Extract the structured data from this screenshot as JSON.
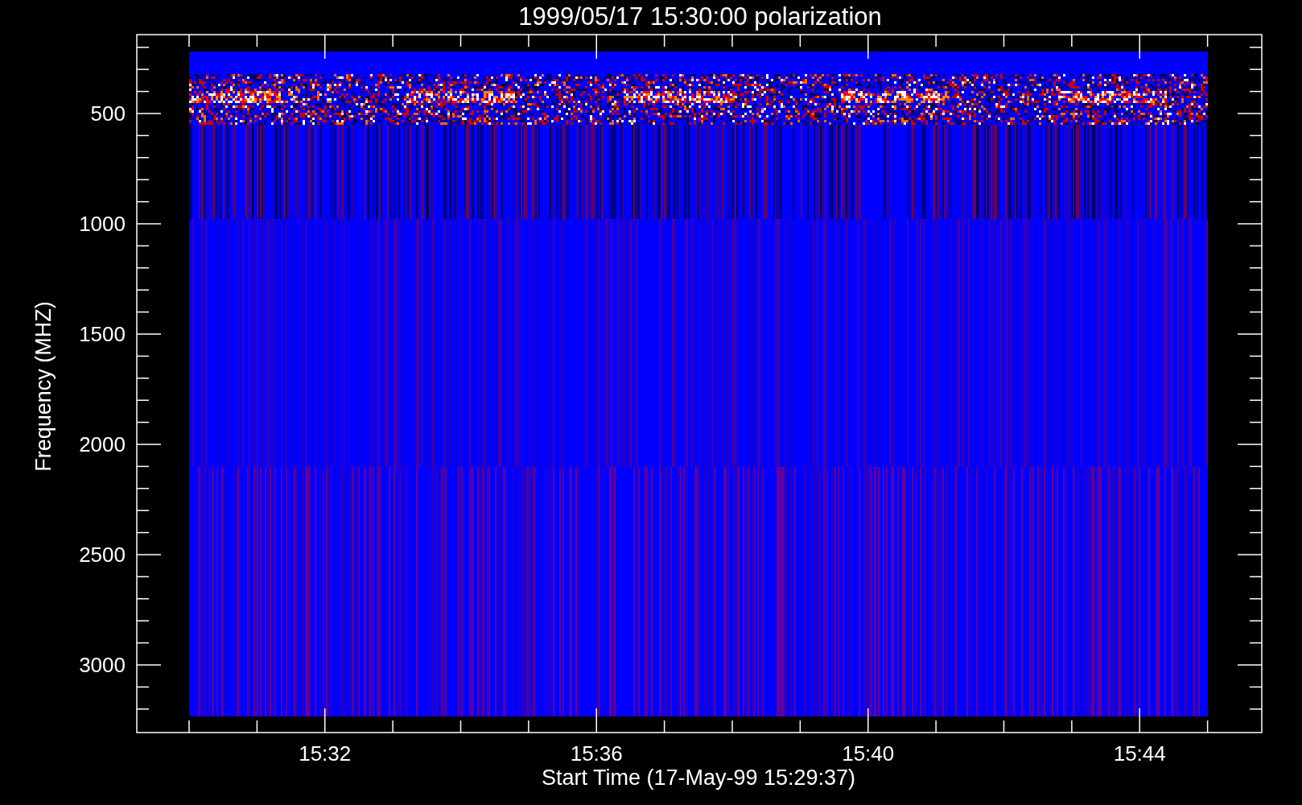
{
  "plot": {
    "title": "1999/05/17 15:30:00 polarization",
    "y_axis": {
      "label": "Frequency (MHZ)",
      "tick_labels": [
        "500",
        "1000",
        "1500",
        "2000",
        "2500",
        "3000"
      ]
    },
    "x_axis": {
      "label": "Start Time (17-May-99 15:29:37)",
      "tick_labels": [
        "15:32",
        "15:36",
        "15:40",
        "15:44"
      ]
    }
  }
}
